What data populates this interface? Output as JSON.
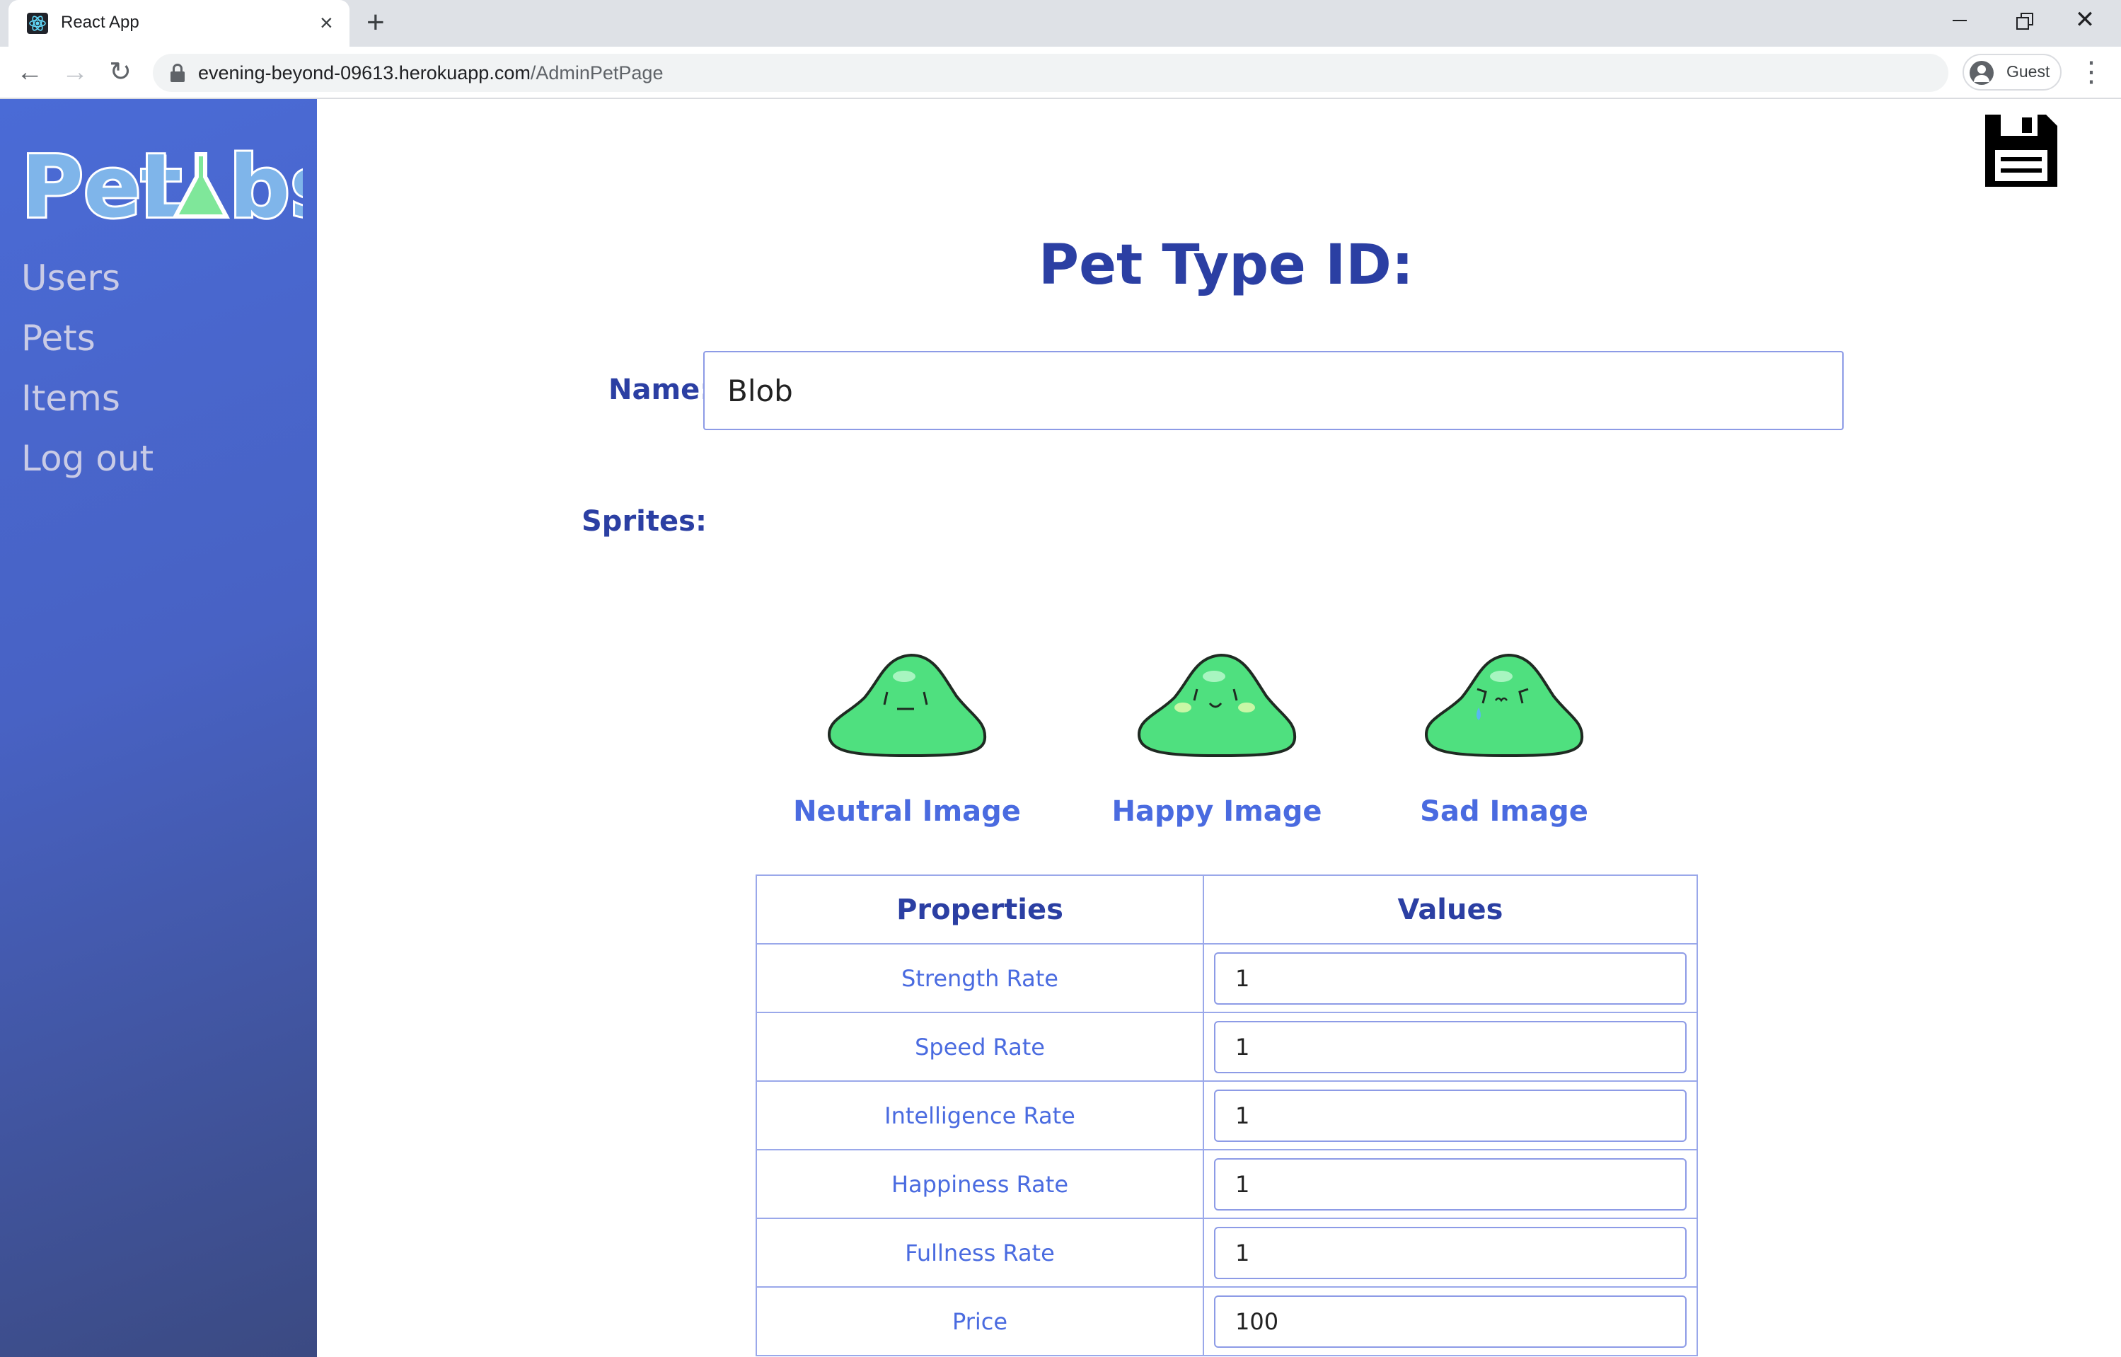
{
  "browser": {
    "tab_title": "React App",
    "url_host": "evening-beyond-09613.herokuapp.com",
    "url_path": "/AdminPetPage",
    "profile_label": "Guest"
  },
  "sidebar": {
    "logo_text": "PetLabs",
    "items": [
      {
        "label": "Users"
      },
      {
        "label": "Pets"
      },
      {
        "label": "Items"
      },
      {
        "label": "Log out"
      }
    ]
  },
  "main": {
    "title": "Pet Type ID:",
    "name_label": "Name:",
    "name_value": "Blob",
    "sprites_label": "Sprites:",
    "sprites": [
      {
        "caption": "Neutral Image",
        "color": "#4fe07f"
      },
      {
        "caption": "Happy Image",
        "color": "#4fe07f"
      },
      {
        "caption": "Sad Image",
        "color": "#4fe07f"
      }
    ],
    "table": {
      "headers": [
        "Properties",
        "Values"
      ],
      "rows": [
        {
          "property": "Strength Rate",
          "value": "1"
        },
        {
          "property": "Speed Rate",
          "value": "1"
        },
        {
          "property": "Intelligence Rate",
          "value": "1"
        },
        {
          "property": "Happiness Rate",
          "value": "1"
        },
        {
          "property": "Fullness Rate",
          "value": "1"
        },
        {
          "property": "Price",
          "value": "100"
        }
      ]
    }
  },
  "colors": {
    "primary": "#2b3fa3",
    "accent": "#4a6be0",
    "sidebar_top": "#4a6bd6",
    "sidebar_bottom": "#3b4a82",
    "slime": "#4fe07f"
  },
  "icons": {
    "save": "floppy-disk-icon",
    "lock": "lock-icon",
    "profile": "account-circle-icon"
  }
}
